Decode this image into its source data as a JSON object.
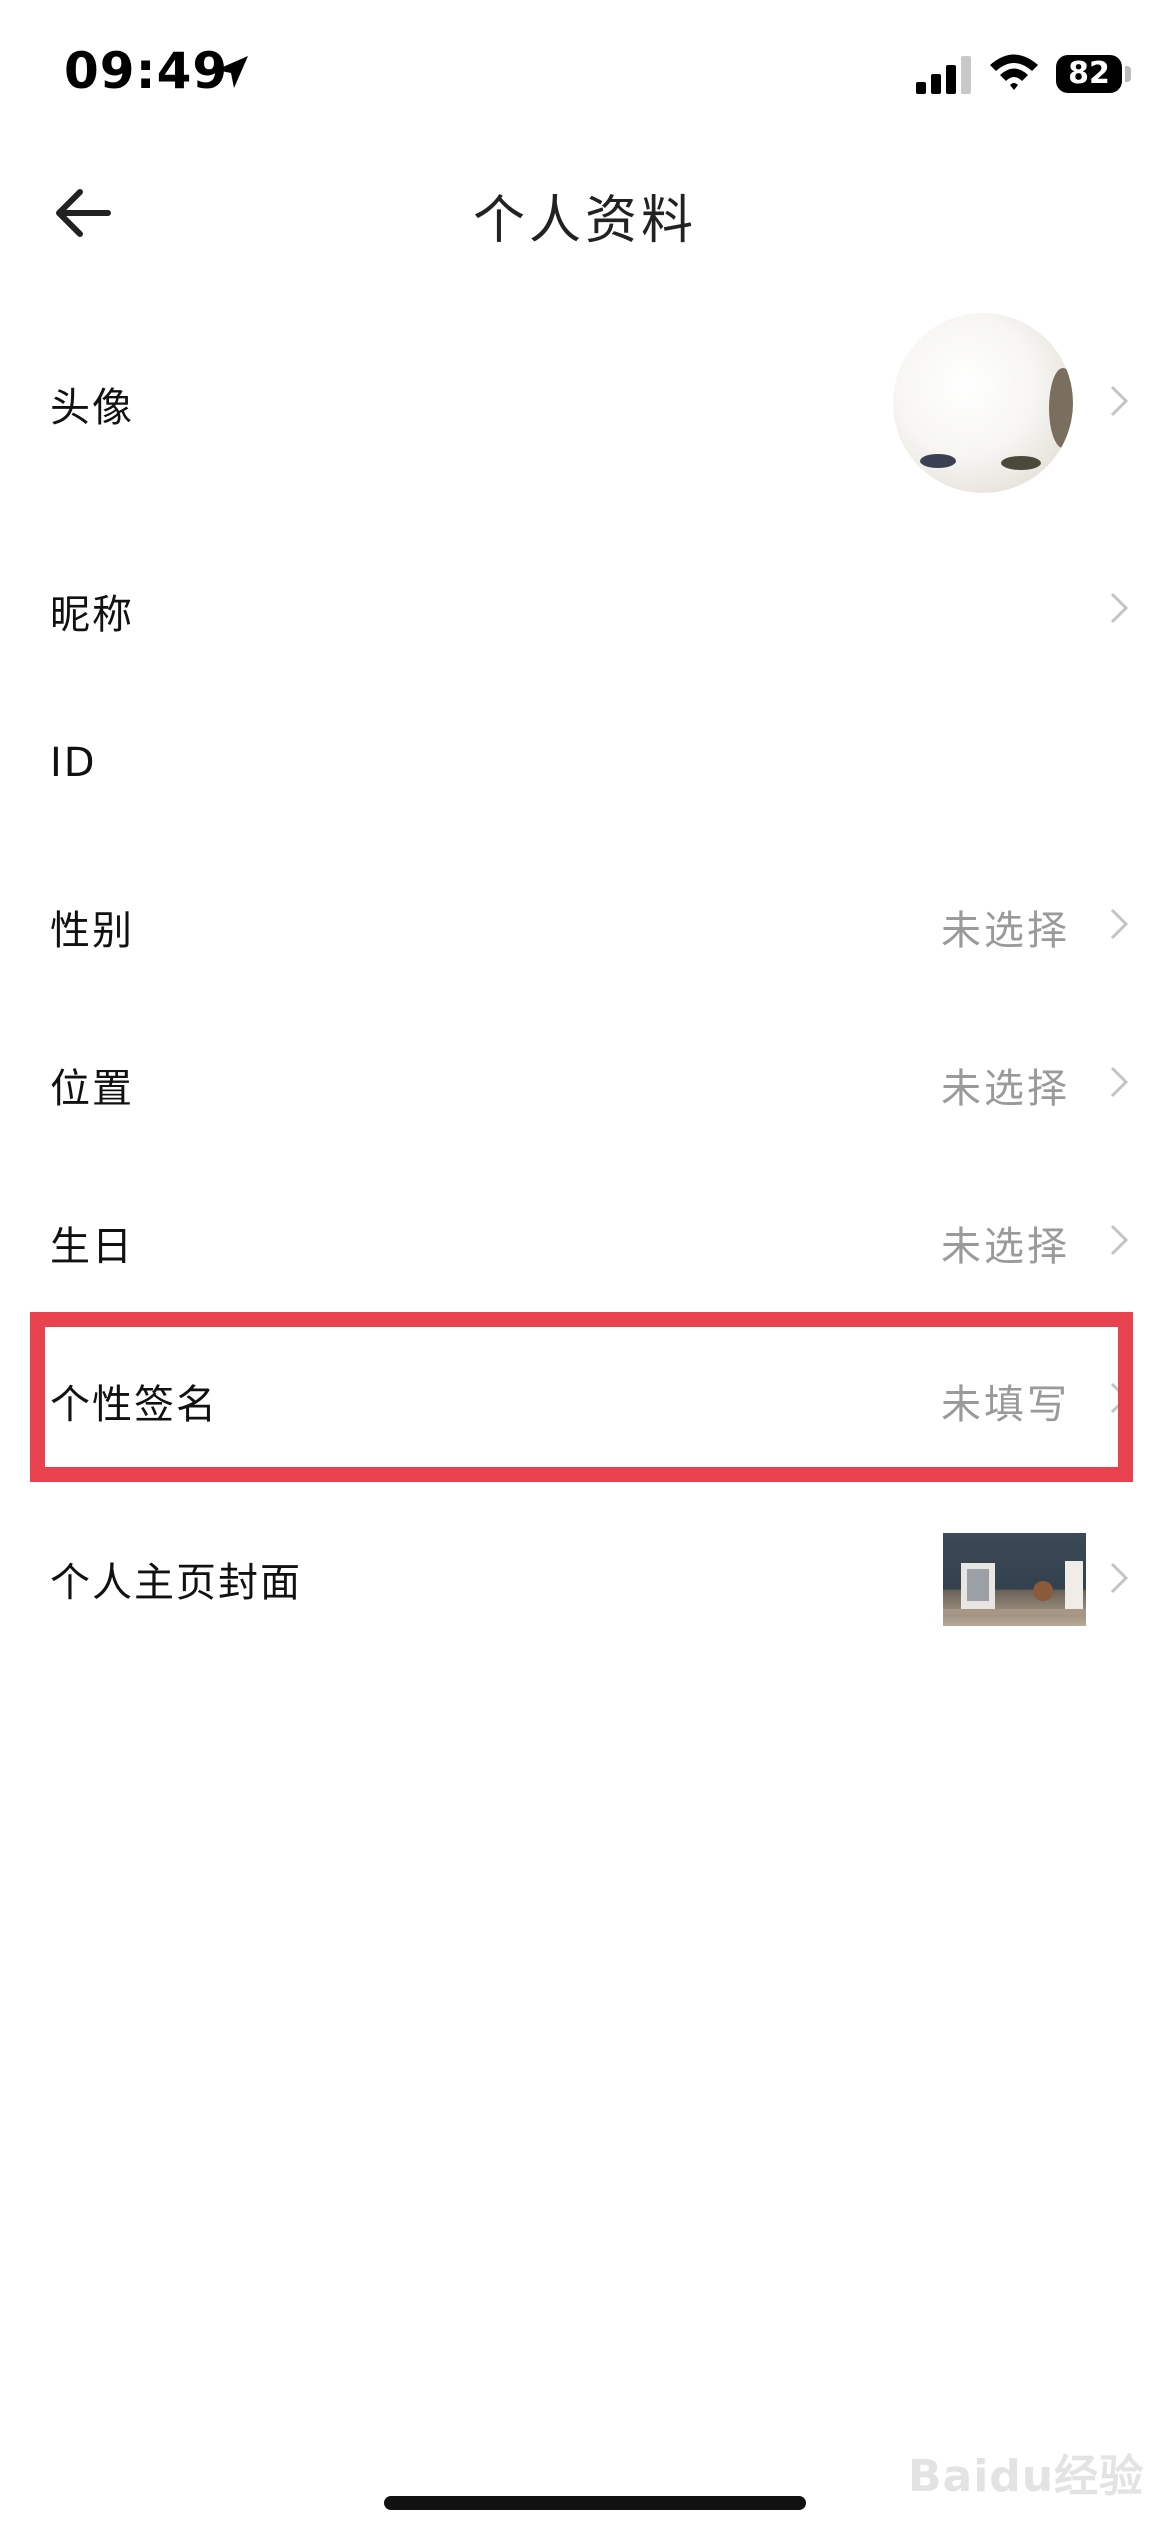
{
  "status_bar": {
    "time": "09:49",
    "battery": "82",
    "icons": [
      "location-arrow-icon",
      "cellular-signal-icon",
      "wifi-icon",
      "battery-icon"
    ]
  },
  "nav": {
    "title": "个人资料",
    "back_icon": "back-arrow-icon"
  },
  "rows": {
    "avatar": {
      "label": "头像"
    },
    "nickname": {
      "label": "昵称"
    },
    "id": {
      "label": "ID"
    },
    "gender": {
      "label": "性别",
      "value": "未选择"
    },
    "location": {
      "label": "位置",
      "value": "未选择"
    },
    "birthday": {
      "label": "生日",
      "value": "未选择"
    },
    "signature": {
      "label": "个性签名",
      "value": "未填写"
    },
    "cover": {
      "label": "个人主页封面"
    }
  },
  "highlight_color": "#e8424f",
  "watermark": "Baidu经验"
}
